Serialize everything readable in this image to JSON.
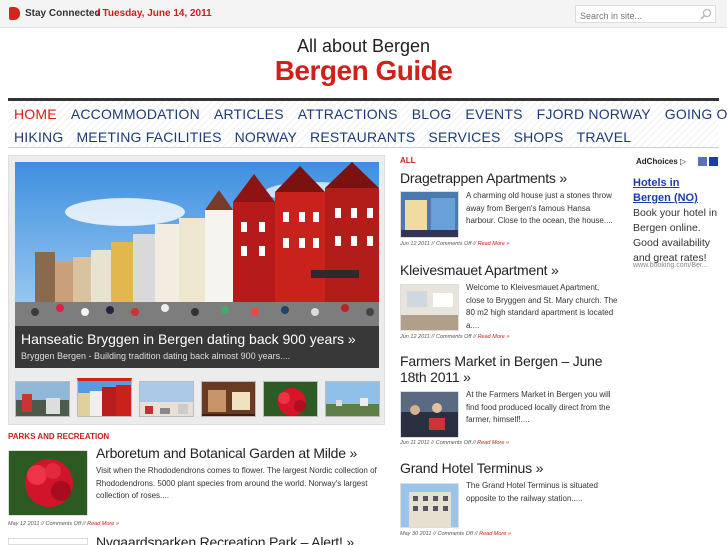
{
  "topbar": {
    "stay_connected": "Stay Connected",
    "date": "/ Tuesday, June 14, 2011",
    "search_placeholder": "Search in site..."
  },
  "header": {
    "tagline": "All about Bergen",
    "logo": "Bergen Guide"
  },
  "nav": {
    "row1": [
      "HOME",
      "ACCOMMODATION",
      "ARTICLES",
      "ATTRACTIONS",
      "BLOG",
      "EVENTS",
      "FJORD NORWAY",
      "GOING OUT"
    ],
    "row2": [
      "HIKING",
      "MEETING FACILITIES",
      "NORWAY",
      "RESTAURANTS",
      "SERVICES",
      "SHOPS",
      "TRAVEL"
    ],
    "active": "HOME"
  },
  "featured": {
    "title": "Hanseatic Bryggen in Bergen dating back 900 years »",
    "excerpt": "Bryggen Bergen - Building tradition dating back almost 900 years...."
  },
  "parks": {
    "label": "PARKS AND RECREATION",
    "posts": [
      {
        "title": "Arboretum and Botanical Garden at Milde »",
        "excerpt": "Visit when the Rhododendrons comes to flower. The largest Nordic collection of Rhododendrons. 5000 plant species from around the world. Norway's largest collection of roses....",
        "date": "May 12 2011",
        "comments": "Comments Off",
        "more": "Read More »"
      },
      {
        "title": "Nygaardsparken Recreation Park – Alert! »"
      }
    ]
  },
  "all": {
    "label": "ALL",
    "posts": [
      {
        "title": "Dragetrappen Apartments »",
        "excerpt": "A charming old house just a stones throw away from Bergen's famous Hansa harbour. Close to the ocean, the house....",
        "date": "Jun 12 2011",
        "comments": "Comments Off",
        "more": "Read More »"
      },
      {
        "title": "Kleivesmauet Apartment »",
        "excerpt": "Welcome to Kleivesmauet Apartment, close to Bryggen and St. Mary church. The 80 m2 high standard apartment is located a....",
        "date": "Jun 12 2011",
        "comments": "Comments Off",
        "more": "Read More »"
      },
      {
        "title": "Farmers Market in Bergen – June 18th 2011 »",
        "excerpt": "At the Farmers Market in Bergen you will find food produced locally direct from the farmer, himself!....",
        "date": "Jun 11 2011",
        "comments": "Comments Off",
        "more": "Read More »"
      },
      {
        "title": "Grand Hotel Terminus »",
        "excerpt": "The Grand Hotel Terminus is situated opposite to the railway station.....",
        "date": "May 30 2011",
        "comments": "Comments Off",
        "more": "Read More »"
      }
    ]
  },
  "ad": {
    "adchoices": "AdChoices",
    "title": "Hotels in Bergen (NO)",
    "body": "Book your hotel in Bergen online. Good availability and great rates!",
    "url": "www.booking.com/Ber..."
  },
  "colors": {
    "accent": "#d1201a",
    "nav_text": "#1c3b75",
    "ad_link": "#1a3dab"
  }
}
